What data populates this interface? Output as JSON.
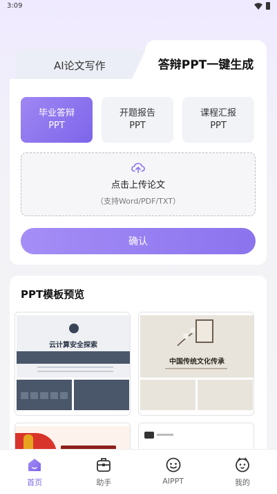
{
  "status": {
    "time": "3:09"
  },
  "tabs": [
    {
      "label": "AI论文写作",
      "active": false
    },
    {
      "label": "答辩PPT一键生成",
      "active": true
    }
  ],
  "types": [
    {
      "line1": "毕业答辩",
      "line2": "PPT",
      "active": true
    },
    {
      "line1": "开题报告",
      "line2": "PPT",
      "active": false
    },
    {
      "line1": "课程汇报",
      "line2": "PPT",
      "active": false
    }
  ],
  "upload": {
    "icon": "cloud-upload-icon",
    "title": "点击上传论文",
    "hint": "（支持Word/PDF/TXT）"
  },
  "confirm_label": "确认",
  "preview": {
    "title": "PPT模板预览",
    "templates": [
      {
        "title": "云计算安全探索"
      },
      {
        "title": "中国传统文化传承"
      }
    ]
  },
  "nav": [
    {
      "label": "首页",
      "icon": "home-icon",
      "active": true
    },
    {
      "label": "助手",
      "icon": "assistant-icon",
      "active": false
    },
    {
      "label": "AIPPT",
      "icon": "aippt-icon",
      "active": false
    },
    {
      "label": "我的",
      "icon": "profile-icon",
      "active": false
    }
  ],
  "colors": {
    "accent": "#7d65ea",
    "accent_light": "#a58ef6"
  }
}
